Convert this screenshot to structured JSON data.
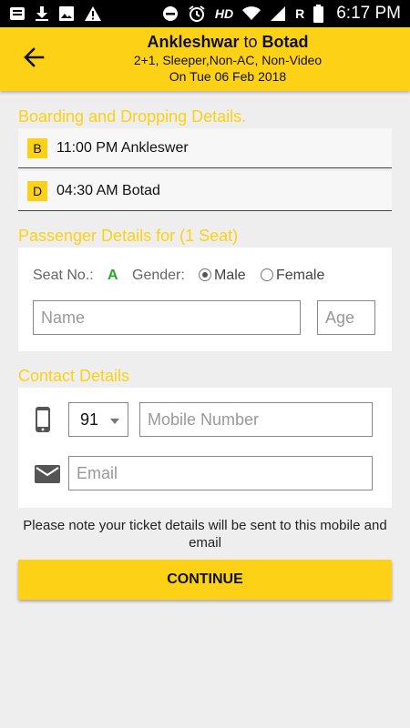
{
  "status_bar": {
    "time": "6:17 PM",
    "hd": "HD",
    "roaming": "R",
    "left_icons": [
      "message-icon",
      "download-icon",
      "image-icon",
      "warning-icon"
    ],
    "right_icons": [
      "dnd-icon",
      "alarm-icon",
      "wifi-icon",
      "signal-icon",
      "battery-icon"
    ]
  },
  "header": {
    "from": "Ankleshwar",
    "to_word": "to",
    "to": "Botad",
    "bus_info": "2+1, Sleeper,Non-AC, Non-Video",
    "date": "On Tue 06 Feb 2018"
  },
  "boarding": {
    "title": "Boarding and Dropping Details.",
    "boarding_tag": "B",
    "boarding_text": "11:00 PM Ankleswer",
    "dropping_tag": "D",
    "dropping_text": "04:30 AM Botad"
  },
  "passenger": {
    "title": "Passenger Details for (1 Seat)",
    "seat_label": "Seat No.:",
    "seat_value": "A",
    "gender_label": "Gender:",
    "male": "Male",
    "female": "Female",
    "selected_gender": "Male",
    "name_placeholder": "Name",
    "age_placeholder": "Age"
  },
  "contact": {
    "title": "Contact Details",
    "country_code": "91",
    "mobile_placeholder": "Mobile Number",
    "email_placeholder": "Email"
  },
  "note": "Please note your ticket details will be sent to this mobile and email",
  "continue_label": "CONTINUE",
  "colors": {
    "accent": "#fcd116",
    "seat": "#2aa52a",
    "background": "#eeeeee"
  }
}
